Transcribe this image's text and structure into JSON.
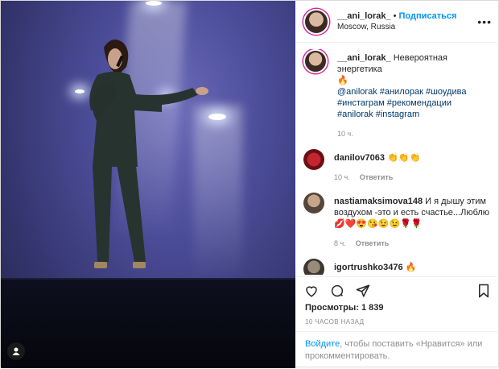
{
  "post": {
    "username": "__ani_lorak_",
    "dot": "•",
    "follow_label": "Подписаться",
    "location": "Moscow, Russia",
    "more_label": "•••"
  },
  "caption": {
    "username": "__ani_lorak_",
    "text": "Невероятная энергетика",
    "fire": "🔥",
    "tags_line1": "@anilorak #анилорак #шоудива",
    "tags_line2": "#инстаграм #рекомендации",
    "tags_line3": "#anilorak #instagram",
    "time": "10 ч."
  },
  "comments": [
    {
      "username": "danilov7063",
      "text": "👏👏👏",
      "time": "10 ч.",
      "reply": "Ответить"
    },
    {
      "username": "nastiamaksimova148",
      "text": "И я дышу этим воздухом -это и есть счастье...Люблю 💋❤️😍😘😉😉🌹🌹",
      "time": "8 ч.",
      "reply": "Ответить"
    },
    {
      "username": "igortrushko3476",
      "text": "🔥"
    }
  ],
  "actions": {
    "like": "heart-icon",
    "comment": "comment-icon",
    "share": "share-icon",
    "save": "bookmark-icon"
  },
  "views": {
    "label": "Просмотры:",
    "count": "1 839"
  },
  "timestamp": "10 ЧАСОВ НАЗАД",
  "login": {
    "link": "Войдите",
    "text": ", чтобы поставить «Нравится» или прокомментировать."
  },
  "colors": {
    "accent": "#0095f6",
    "text": "#262626",
    "muted": "#8e8e8e",
    "stage": "#4b4c98"
  }
}
